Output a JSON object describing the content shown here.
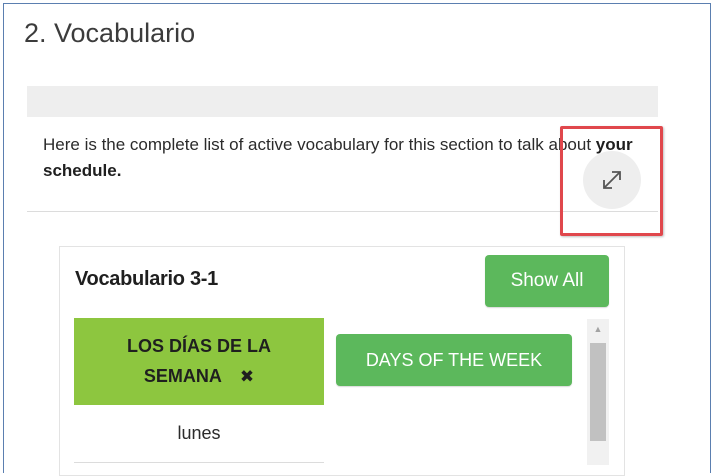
{
  "section": {
    "title": "2. Vocabulario"
  },
  "intro": {
    "text": "Here is the complete list of active vocabulary for this section to talk about ",
    "bold": "your schedule."
  },
  "expand": {
    "icon": "expand-arrows-icon"
  },
  "vocab": {
    "title": "Vocabulario 3-1",
    "show_all_label": "Show All",
    "category": {
      "line1": "LOS DÍAS DE LA",
      "line2": "SEMANA",
      "close_symbol": "✖"
    },
    "category_button_label": "DAYS OF THE WEEK",
    "words": [
      "lunes"
    ]
  },
  "colors": {
    "accent_green": "#5cb85c",
    "category_green": "#8dc63f",
    "highlight_red": "#e0474c",
    "frame_blue": "#5b7fb0"
  }
}
